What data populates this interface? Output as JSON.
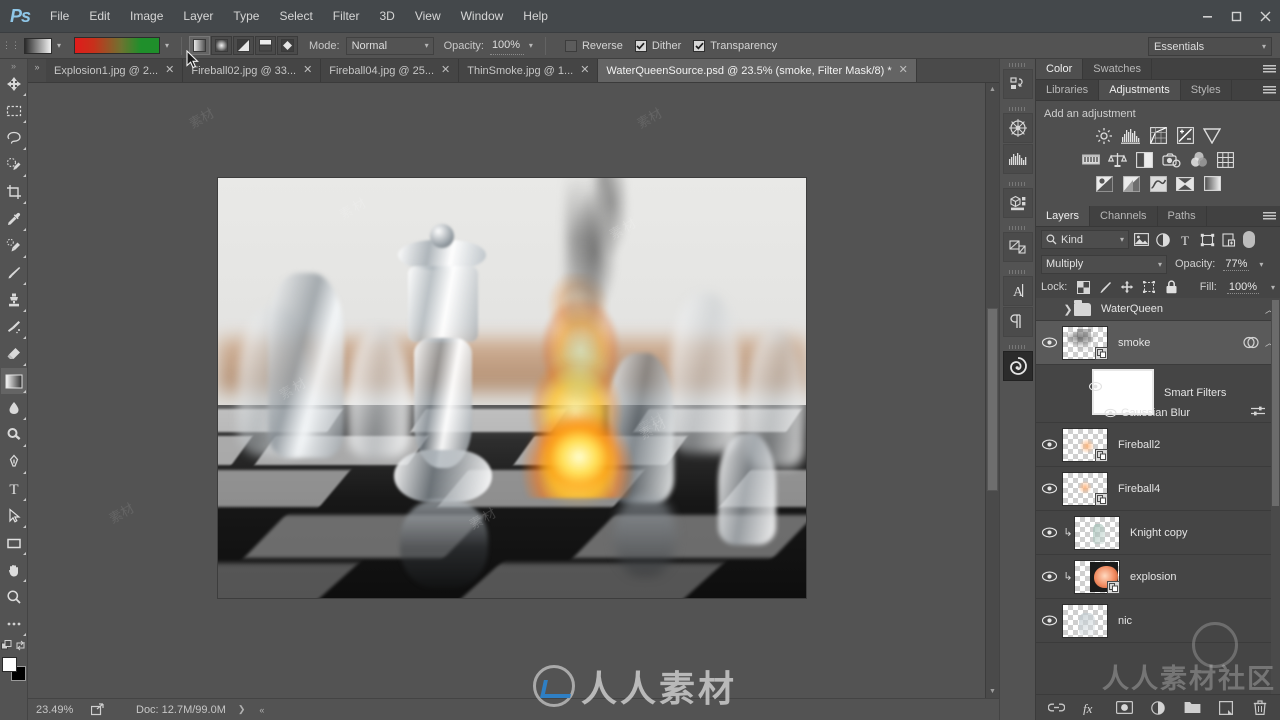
{
  "app": {
    "name": "Ps",
    "logo_text": "Ps"
  },
  "menubar": {
    "items": [
      "File",
      "Edit",
      "Image",
      "Layer",
      "Type",
      "Select",
      "Filter",
      "3D",
      "View",
      "Window",
      "Help"
    ],
    "window_controls": [
      "minimize",
      "maximize",
      "close"
    ]
  },
  "options_bar": {
    "gradient_preset_label": "gradient-preset",
    "gradient_colors": [
      "#e01b1b",
      "#6e7330",
      "#1f8f2b"
    ],
    "gradient_types": [
      "linear-gradient",
      "radial-gradient",
      "angle-gradient",
      "reflected-gradient",
      "diamond-gradient"
    ],
    "active_gradient_type": "linear-gradient",
    "mode_label": "Mode:",
    "mode_value": "Normal",
    "opacity_label": "Opacity:",
    "opacity_value": "100%",
    "reverse_label": "Reverse",
    "reverse_checked": false,
    "dither_label": "Dither",
    "dither_checked": true,
    "transparency_label": "Transparency",
    "transparency_checked": true,
    "workspace_value": "Essentials"
  },
  "toolbar": {
    "tools": [
      {
        "name": "move-tool",
        "active": false
      },
      {
        "name": "rectangular-marquee-tool",
        "active": false
      },
      {
        "name": "lasso-tool",
        "active": false
      },
      {
        "name": "quick-selection-tool",
        "active": false
      },
      {
        "name": "crop-tool",
        "active": false
      },
      {
        "name": "eyedropper-tool",
        "active": false
      },
      {
        "name": "spot-healing-brush-tool",
        "active": false
      },
      {
        "name": "brush-tool",
        "active": false
      },
      {
        "name": "clone-stamp-tool",
        "active": false
      },
      {
        "name": "history-brush-tool",
        "active": false
      },
      {
        "name": "eraser-tool",
        "active": false
      },
      {
        "name": "gradient-tool",
        "active": true
      },
      {
        "name": "blur-tool",
        "active": false
      },
      {
        "name": "dodge-tool",
        "active": false
      },
      {
        "name": "pen-tool",
        "active": false
      },
      {
        "name": "type-tool",
        "active": false
      },
      {
        "name": "path-selection-tool",
        "active": false
      },
      {
        "name": "rectangle-tool",
        "active": false
      },
      {
        "name": "hand-tool",
        "active": false
      },
      {
        "name": "zoom-tool",
        "active": false
      },
      {
        "name": "edit-toolbar-tool",
        "active": false
      }
    ],
    "foreground_color": "#ffffff",
    "background_color": "#000000"
  },
  "tabs": [
    {
      "label": "Explosion1.jpg @ 2...",
      "active": false
    },
    {
      "label": "Fireball02.jpg @ 33...",
      "active": false
    },
    {
      "label": "Fireball04.jpg @ 25...",
      "active": false
    },
    {
      "label": "ThinSmoke.jpg @ 1...",
      "active": false
    },
    {
      "label": "WaterQueenSource.psd @ 23.5% (smoke, Filter Mask/8) *",
      "active": true
    }
  ],
  "canvas": {
    "description": "glass chess pieces on reflective chessboard with burning queen piece and rising smoke",
    "watermark_marks": [
      "素材",
      "素材",
      "素材",
      "素材",
      "素材"
    ]
  },
  "statusbar": {
    "zoom": "23.49%",
    "doc_label": "Doc: 12.7M/99.0M",
    "share_icon": "share-icon"
  },
  "rail": {
    "buttons": [
      "history-icon",
      "navigator-icon",
      "histogram-icon",
      "3d-icon",
      "layer-comps-icon",
      "character-icon",
      "paragraph-icon",
      "actions-icon"
    ]
  },
  "color_panel": {
    "tabs": [
      {
        "label": "Color",
        "active": true
      },
      {
        "label": "Swatches",
        "active": false
      }
    ]
  },
  "adjustments_panel": {
    "tabs": [
      {
        "label": "Libraries",
        "active": false
      },
      {
        "label": "Adjustments",
        "active": true
      },
      {
        "label": "Styles",
        "active": false
      }
    ],
    "title": "Add an adjustment",
    "rows": [
      [
        "brightness-contrast-icon",
        "levels-icon",
        "curves-icon",
        "exposure-icon",
        "vibrance-icon"
      ],
      [
        "hue-saturation-icon",
        "color-balance-icon",
        "black-white-icon",
        "photo-filter-icon",
        "channel-mixer-icon",
        "color-lookup-icon"
      ],
      [
        "invert-icon",
        "posterize-icon",
        "threshold-icon",
        "selective-color-icon",
        "gradient-map-icon"
      ]
    ]
  },
  "layers_panel": {
    "tabs": [
      {
        "label": "Layers",
        "active": true
      },
      {
        "label": "Channels",
        "active": false
      },
      {
        "label": "Paths",
        "active": false
      }
    ],
    "filter_kind": "Kind",
    "filter_icons": [
      "pixel-filter-icon",
      "adjustment-filter-icon",
      "type-filter-icon",
      "shape-filter-icon",
      "smart-object-filter-icon"
    ],
    "blend_mode": "Multiply",
    "opacity_label": "Opacity:",
    "opacity_value": "77%",
    "lock_label": "Lock:",
    "lock_icons": [
      "lock-transparent-pixels-icon",
      "lock-image-pixels-icon",
      "lock-position-icon",
      "lock-artboard-icon",
      "lock-all-icon"
    ],
    "fill_label": "Fill:",
    "fill_value": "100%",
    "layers": [
      {
        "name": "WaterQueen",
        "type": "group",
        "visible": false,
        "selected": false
      },
      {
        "name": "smoke",
        "type": "smart-object",
        "visible": true,
        "selected": true,
        "has_smart_filters": true
      },
      {
        "name": "Smart Filters",
        "type": "smart-filters-mask",
        "visible": true
      },
      {
        "name": "Gaussian Blur",
        "type": "smart-filter",
        "visible": true
      },
      {
        "name": "Fireball2",
        "type": "smart-object",
        "visible": true,
        "selected": false
      },
      {
        "name": "Fireball4",
        "type": "smart-object",
        "visible": true,
        "selected": false
      },
      {
        "name": "Knight copy",
        "type": "clipped",
        "visible": true,
        "selected": false
      },
      {
        "name": "explosion",
        "type": "clipped-smart-object",
        "visible": true,
        "selected": false
      },
      {
        "name": "nic",
        "type": "layer",
        "visible": true,
        "selected": false
      }
    ],
    "footer_buttons": [
      "link-layers-icon",
      "add-layer-style-icon",
      "add-layer-mask-icon",
      "new-fill-adjustment-icon",
      "new-group-icon",
      "new-layer-icon",
      "delete-layer-icon"
    ]
  },
  "watermark": {
    "text": "人人素材",
    "panel_text": "人人素材社区"
  }
}
